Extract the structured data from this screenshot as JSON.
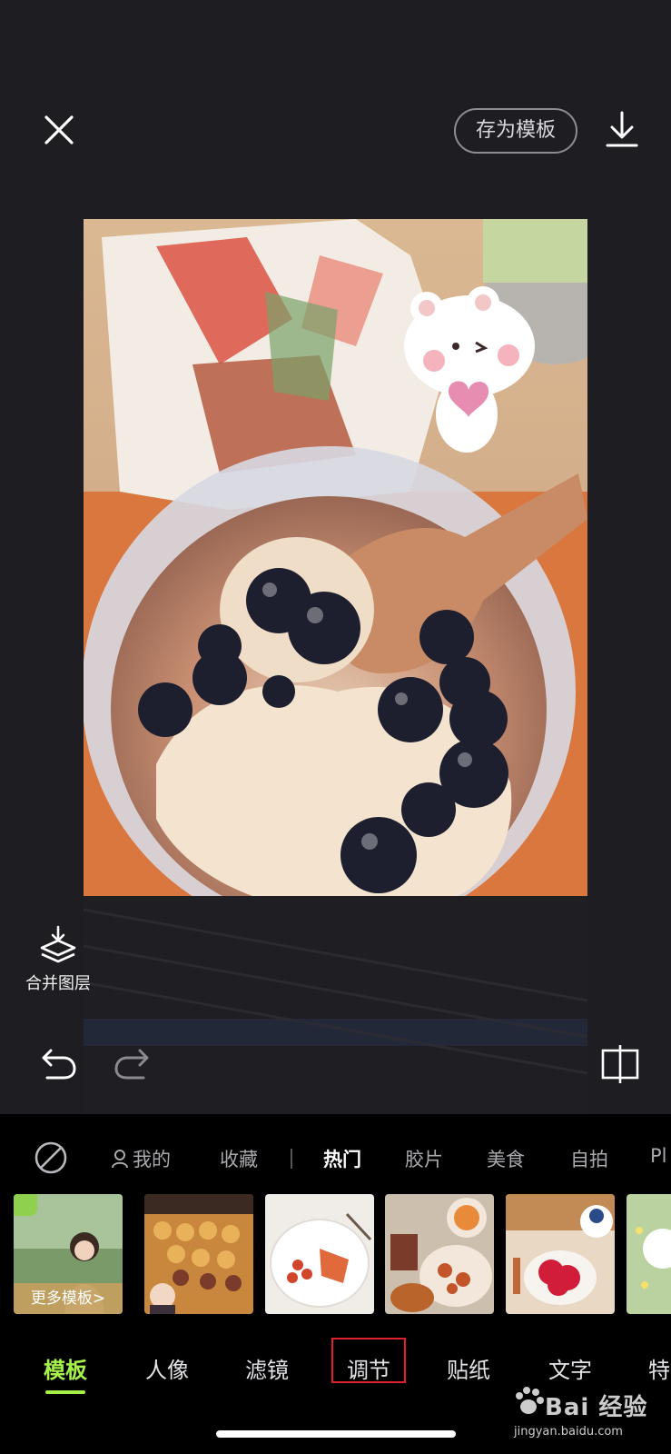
{
  "top_bar": {
    "save_template_label": "存为模板"
  },
  "side_tools": {
    "merge_layers_label": "合并图层"
  },
  "categories": {
    "items": [
      "我的",
      "收藏",
      "热门",
      "胶片",
      "美食",
      "自拍",
      "Pl"
    ],
    "active": "热门"
  },
  "templates": {
    "more_label": "更多模板>"
  },
  "tool_tabs": {
    "items": [
      "模板",
      "人像",
      "滤镜",
      "调节",
      "贴纸",
      "文字",
      "特"
    ],
    "active": "模板",
    "highlighted": "调节"
  },
  "watermark": {
    "brand": "Bai 经验",
    "url": "jingyan.baidu.com"
  },
  "colors": {
    "accent": "#a6f04a",
    "highlight_box": "#e0202a",
    "background": "#1e1d22",
    "panel": "#000000"
  }
}
